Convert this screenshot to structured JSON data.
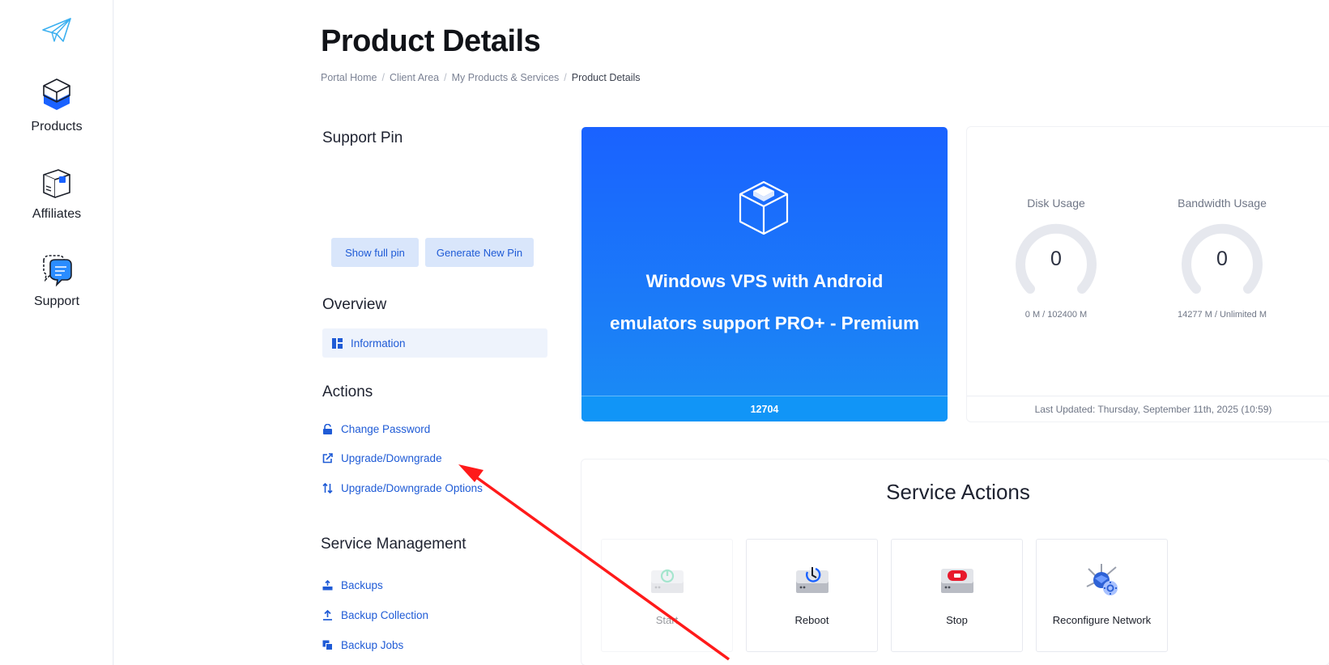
{
  "sidebar": {
    "items": [
      {
        "label": "Products",
        "icon": "box-stack-icon"
      },
      {
        "label": "Affiliates",
        "icon": "package-icon"
      },
      {
        "label": "Support",
        "icon": "chat-support-icon"
      }
    ]
  },
  "header": {
    "title": "Product Details",
    "breadcrumb": [
      "Portal Home",
      "Client Area",
      "My Products & Services",
      "Product Details"
    ]
  },
  "support_pin": {
    "heading": "Support Pin",
    "show_label": "Show full pin",
    "generate_label": "Generate New Pin"
  },
  "overview": {
    "heading": "Overview",
    "information_label": "Information"
  },
  "actions": {
    "heading": "Actions",
    "items": [
      {
        "label": "Change Password",
        "icon": "lock-icon"
      },
      {
        "label": "Upgrade/Downgrade",
        "icon": "external-link-icon"
      },
      {
        "label": "Upgrade/Downgrade Options",
        "icon": "sort-arrows-icon"
      }
    ]
  },
  "service_management": {
    "heading": "Service Management",
    "items": [
      {
        "label": "Backups",
        "icon": "tray-upload-icon"
      },
      {
        "label": "Backup Collection",
        "icon": "upload-icon"
      },
      {
        "label": "Backup Jobs",
        "icon": "copy-icon"
      }
    ]
  },
  "product": {
    "name_line1": "Windows VPS with Android",
    "name_line2": "emulators support PRO+ - Premium",
    "id": "12704"
  },
  "usage": {
    "disk": {
      "title": "Disk Usage",
      "value": "0",
      "detail": "0 M / 102400 M"
    },
    "bandwidth": {
      "title": "Bandwidth Usage",
      "value": "0",
      "detail": "14277 M / Unlimited M"
    },
    "last_updated": "Last Updated: Thursday, September 11th, 2025 (10:59)"
  },
  "service_actions": {
    "title": "Service Actions",
    "tiles": [
      {
        "label": "Start",
        "icon": "power-start-icon"
      },
      {
        "label": "Reboot",
        "icon": "reboot-icon"
      },
      {
        "label": "Stop",
        "icon": "stop-icon"
      },
      {
        "label": "Reconfigure Network",
        "icon": "network-gear-icon"
      }
    ]
  },
  "colors": {
    "accent": "#1f5bd6",
    "card_blue": "#1a6cff",
    "annotation_arrow": "#ff1a1a"
  }
}
